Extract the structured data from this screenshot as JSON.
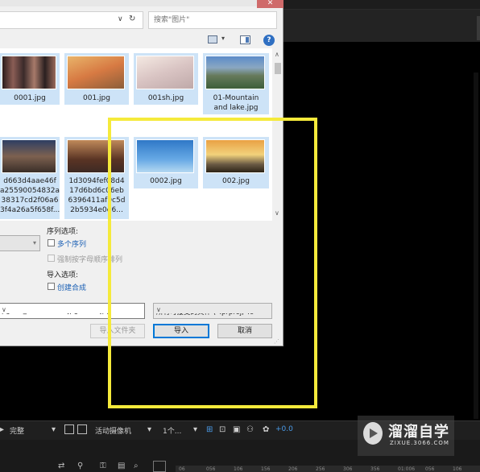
{
  "dialog": {
    "close_glyph": "✕",
    "address": {
      "chevron": "∨",
      "refresh": "↻"
    },
    "search_placeholder": "搜索\"图片\"",
    "toolbar": {
      "view_dropdown": "▾",
      "help": "?"
    },
    "files_row1": [
      {
        "name": "0001.jpg"
      },
      {
        "name": "001.jpg"
      },
      {
        "name": "001sh.jpg"
      },
      {
        "name_lines": [
          "01-Mountain",
          "and lake.jpg"
        ]
      }
    ],
    "files_row2": [
      {
        "name_lines": [
          "d663d4aae46f",
          "a25590054832a",
          "38317cd2f06a6",
          "3f4a26a5f658f..."
        ]
      },
      {
        "name_lines": [
          "1d3094fef08d4",
          "17d6bd6c06eb",
          "6396411af9c5d",
          "2b5934e0d6..."
        ]
      },
      {
        "name": "0002.jpg"
      },
      {
        "name": "002.jpg"
      }
    ],
    "sequence_options": {
      "heading": "序列选项:",
      "multi_sequence": "多个序列",
      "force_alpha": "强制按字母顺序排列"
    },
    "import_options": {
      "heading": "导入选项:",
      "create_comp": "创建合成"
    },
    "filename_value": "pg\" \"1_1920x1080.jpg\" \"1-1.jpg\" \"1-",
    "filter_value": "所有可接受的文件 (*.prproj;*.c",
    "buttons": {
      "import_folder": "导入文件夹",
      "import": "导入",
      "cancel": "取消"
    }
  },
  "bottom_toolbar": {
    "quality": "完整",
    "camera": "活动摄像机",
    "views": "1个...",
    "offset": "+0.0"
  },
  "timeline_ticks": [
    "06",
    "056",
    "106",
    "156",
    "206",
    "256",
    "306",
    "356",
    "01:006",
    "056",
    "106"
  ],
  "watermark": {
    "title": "溜溜自学",
    "subtitle": "ZIXUE.3066.COM"
  },
  "colors": {
    "highlight": "#f5ea3b",
    "selection": "#cde3f7",
    "link": "#1a5fb4"
  }
}
